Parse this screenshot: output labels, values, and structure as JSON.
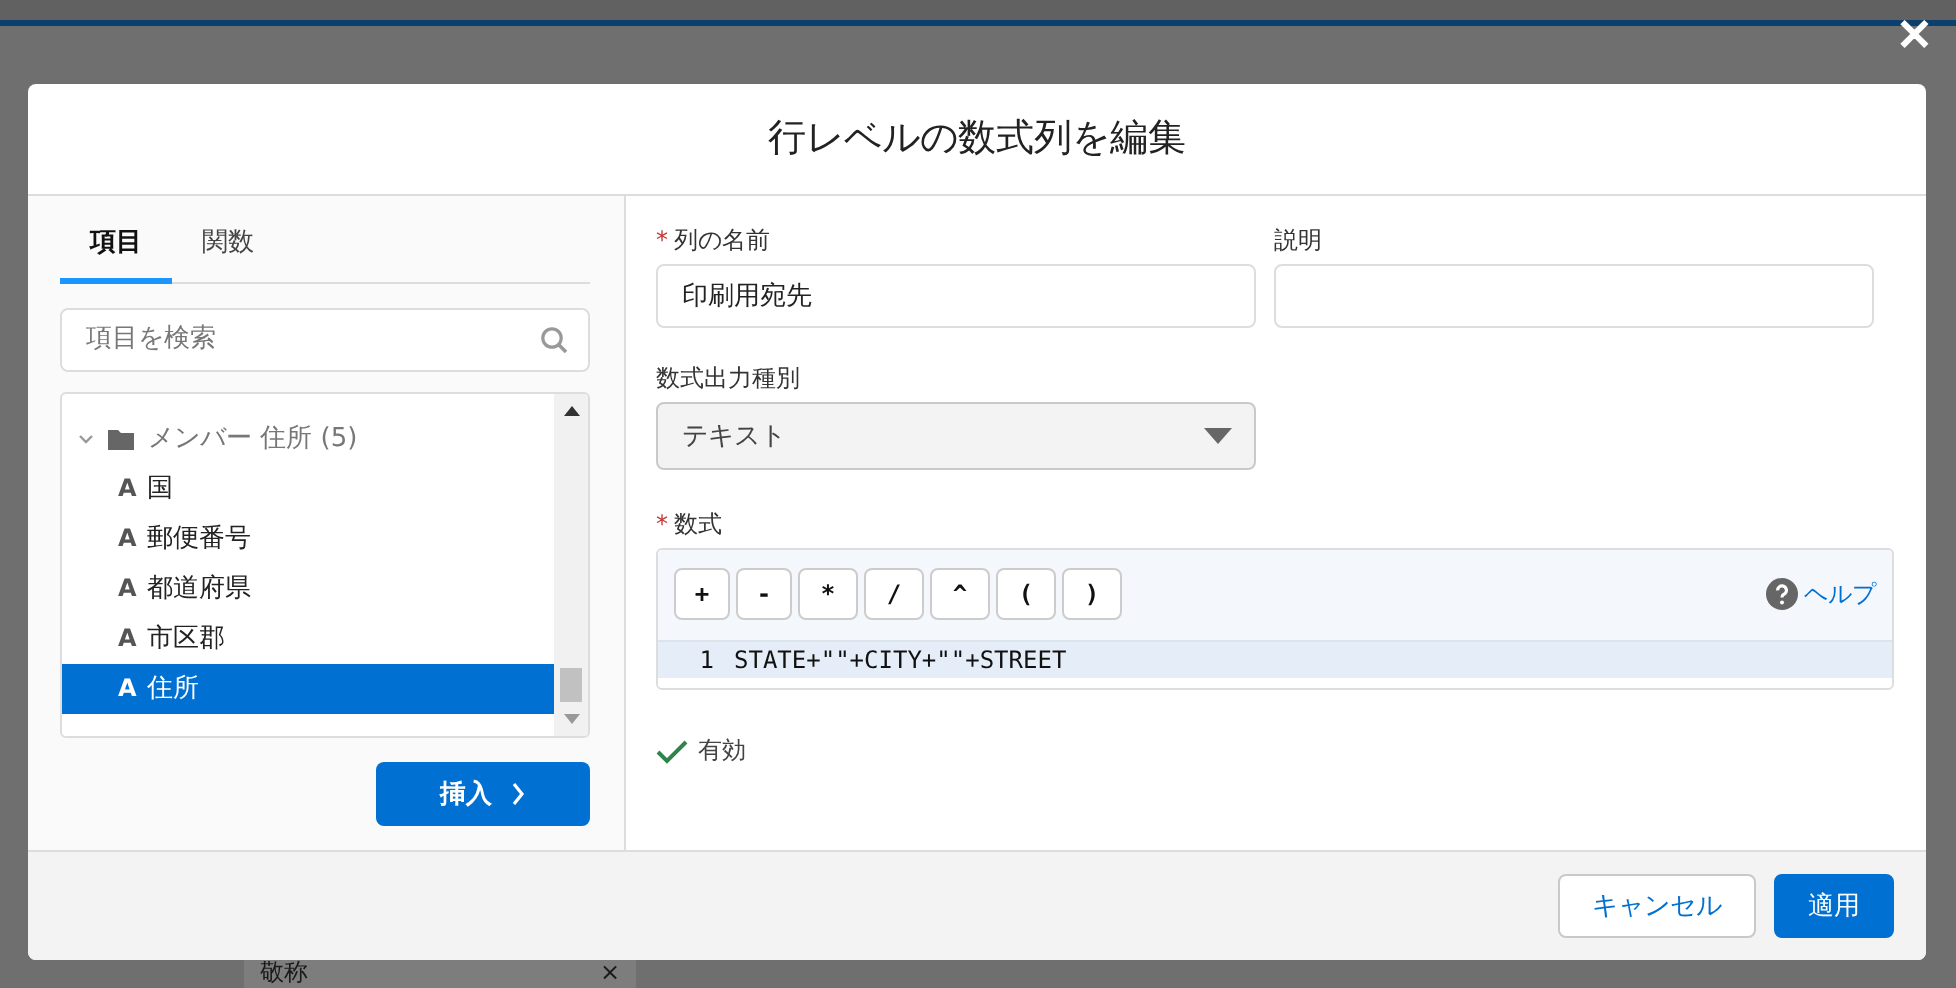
{
  "background": {
    "chip": {
      "label": "敬称",
      "close": "×"
    }
  },
  "close_overlay": "✕",
  "modal": {
    "title": "行レベルの数式列を編集"
  },
  "left_panel": {
    "tabs": [
      {
        "label": "項目",
        "selected": true
      },
      {
        "label": "関数",
        "selected": false
      }
    ],
    "search": {
      "placeholder": "項目を検索"
    },
    "tree": [
      {
        "label": "メンバー 住所 (5)",
        "expanded": true,
        "children": [
          {
            "icon": "A",
            "label": "国",
            "selected": false
          },
          {
            "icon": "A",
            "label": "郵便番号",
            "selected": false
          },
          {
            "icon": "A",
            "label": "都道府県",
            "selected": false
          },
          {
            "icon": "A",
            "label": "市区郡",
            "selected": false
          },
          {
            "icon": "A",
            "label": "住所",
            "selected": true
          }
        ]
      }
    ],
    "insert_button": "挿入"
  },
  "form": {
    "column_name": {
      "label": "列の名前",
      "required": true,
      "value": "印刷用宛先"
    },
    "description": {
      "label": "説明"
    },
    "output_type": {
      "label": "数式出力種別",
      "value": "テキスト"
    },
    "formula": {
      "label": "数式",
      "required": true,
      "operators": [
        "+",
        "-",
        "*",
        "/",
        "^",
        "(",
        ")"
      ],
      "help": "ヘルプ",
      "lines": [
        {
          "number": "1",
          "code": "STATE+\"\"+CITY+\"\"+STREET"
        }
      ]
    },
    "validation": {
      "valid": true,
      "text": "有効"
    }
  },
  "footer": {
    "buttons": [
      {
        "label": "キャンセル",
        "kind": "neutral"
      },
      {
        "label": "適用",
        "kind": "brand"
      }
    ]
  }
}
